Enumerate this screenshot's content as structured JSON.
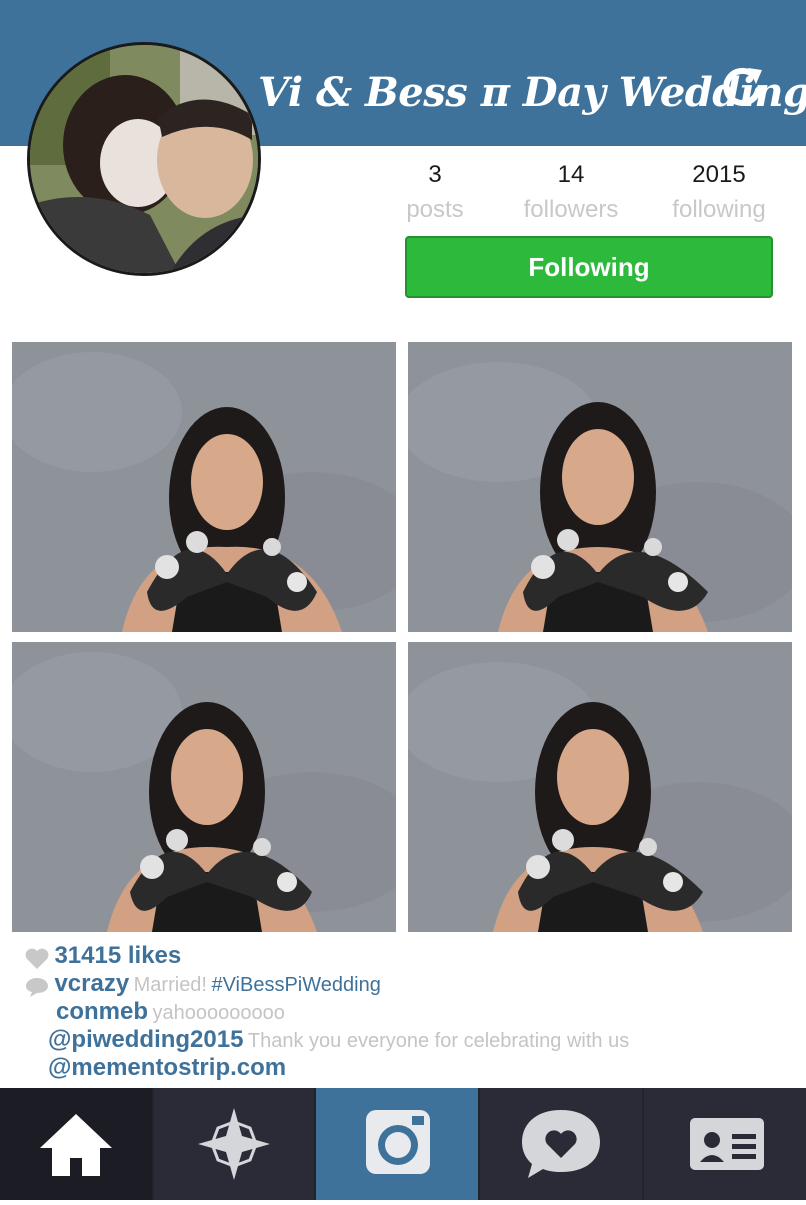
{
  "header": {
    "title": "Vi & Bess π Day Wedding",
    "refresh_icon": "refresh-icon"
  },
  "profile": {
    "avatar": "couple-avatar",
    "stats": [
      {
        "value": "3",
        "label": "posts"
      },
      {
        "value": "14",
        "label": "followers"
      },
      {
        "value": "2015",
        "label": "following"
      }
    ],
    "follow_button_label": "Following"
  },
  "photos": [
    {
      "name": "photo-1"
    },
    {
      "name": "photo-2"
    },
    {
      "name": "photo-3"
    },
    {
      "name": "photo-4"
    }
  ],
  "post": {
    "likes_text": "31415 likes",
    "comments": [
      {
        "user": "vcrazy",
        "text": "Married!",
        "tag": "#ViBessPiWedding"
      },
      {
        "user": "conmeb",
        "text": "yahooooooooo"
      },
      {
        "user": "@piwedding2015",
        "text": "Thank you everyone for celebrating with us"
      }
    ],
    "footer_link": "@mementostrip.com"
  },
  "nav": [
    {
      "icon": "home-icon"
    },
    {
      "icon": "explore-icon"
    },
    {
      "icon": "camera-icon",
      "active": true
    },
    {
      "icon": "activity-heart-icon"
    },
    {
      "icon": "profile-card-icon"
    }
  ],
  "colors": {
    "header_blue": "#3f729b",
    "follow_green": "#2dba3c",
    "nav_dark": "#22232b",
    "muted_text": "#c4c4c4"
  }
}
